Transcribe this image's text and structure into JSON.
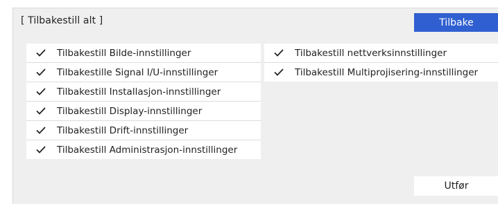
{
  "dialog": {
    "title": "[ Tilbakestill alt ]",
    "back_label": "Tilbake",
    "execute_label": "Utfør",
    "accent_color": "#2f5fd0"
  },
  "left_items": [
    {
      "label": "Tilbakestill Bilde-innstillinger",
      "checked": true,
      "icon": "checkmark-icon"
    },
    {
      "label": "Tilbakestille Signal I/U-innstillinger",
      "checked": true,
      "icon": "checkmark-icon"
    },
    {
      "label": "Tilbakestill Installasjon-innstillinger",
      "checked": true,
      "icon": "checkmark-icon"
    },
    {
      "label": "Tilbakestill Display-innstillinger",
      "checked": true,
      "icon": "checkmark-icon"
    },
    {
      "label": "Tilbakestill Drift-innstillinger",
      "checked": true,
      "icon": "checkmark-icon"
    },
    {
      "label": "Tilbakestill Administrasjon-innstillinger",
      "checked": true,
      "icon": "checkmark-icon"
    }
  ],
  "right_items": [
    {
      "label": "Tilbakestill nettverksinnstillinger",
      "checked": true,
      "icon": "checkmark-icon"
    },
    {
      "label": "Tilbakestill Multiprojisering-innstillinger",
      "checked": true,
      "icon": "checkmark-icon"
    }
  ]
}
